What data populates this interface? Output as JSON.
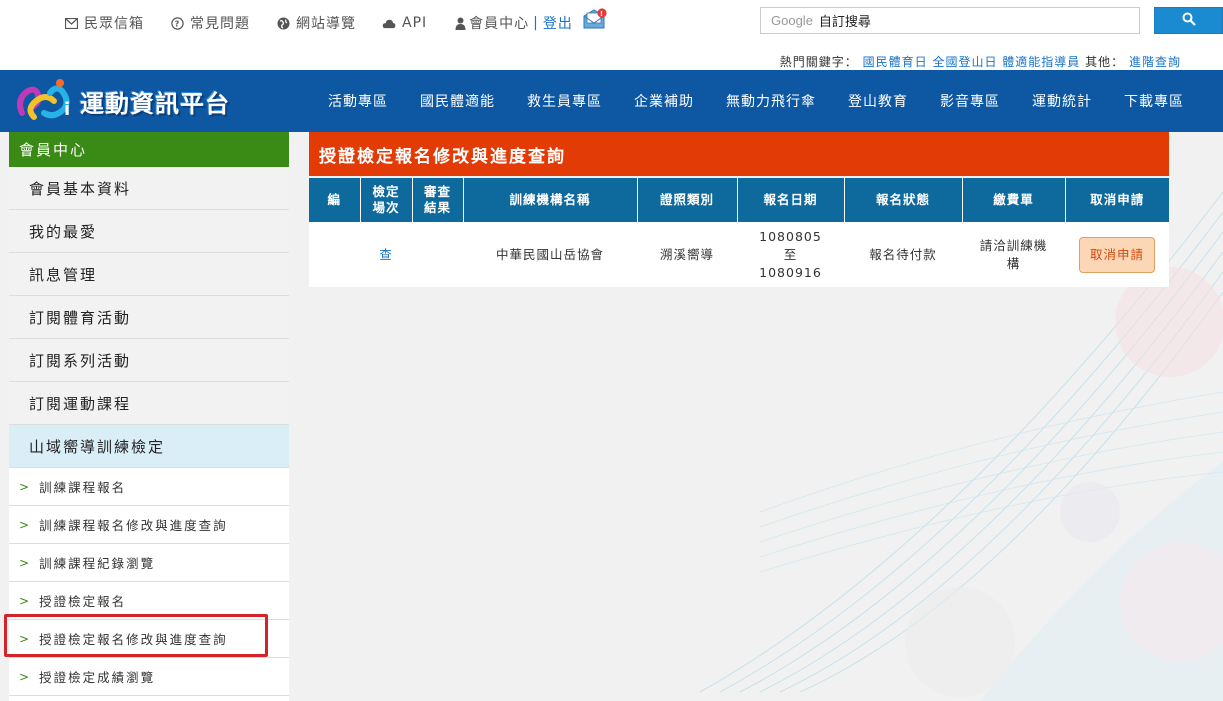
{
  "topbar": {
    "links": [
      {
        "label": "民眾信箱",
        "icon": "envelope-icon"
      },
      {
        "label": "常見問題",
        "icon": "question-icon"
      },
      {
        "label": "網站導覽",
        "icon": "globe-icon"
      },
      {
        "label": "API",
        "icon": "cloud-icon"
      }
    ],
    "member_label": "會員中心",
    "logout_label": "登出",
    "separator": "|",
    "search_brand": "Google",
    "search_placeholder": "自訂搜尋",
    "hotkeys_label": "熱門關鍵字：",
    "hotkeys": [
      "國民體育日",
      "全國登山日",
      "體適能指導員"
    ],
    "other_label": "其他：",
    "advanced_search": "進階查詢"
  },
  "nav": {
    "logo_text": "運動資訊平台",
    "items": [
      "活動專區",
      "國民體適能",
      "救生員專區",
      "企業補助",
      "無動力飛行傘",
      "登山教育",
      "影音專區",
      "運動統計",
      "下載專區"
    ]
  },
  "sidebar": {
    "header": "會員中心",
    "items": [
      "會員基本資料",
      "我的最愛",
      "訊息管理",
      "訂閱體育活動",
      "訂閱系列活動",
      "訂閱運動課程",
      "山域嚮導訓練檢定"
    ],
    "subitems": [
      "訓練課程報名",
      "訓練課程報名修改與進度查詢",
      "訓練課程紀錄瀏覽",
      "授證檢定報名",
      "授證檢定報名修改與進度查詢",
      "授證檢定成績瀏覽"
    ],
    "active_index": 6,
    "highlighted_sub_index": 4
  },
  "main": {
    "title": "授證檢定報名修改與進度查詢",
    "table": {
      "headers": [
        "編",
        "檢定\n場次",
        "審查\n結果",
        "訓練機構名稱",
        "證照類別",
        "報名日期",
        "報名狀態",
        "繳費單",
        "取消申請"
      ],
      "rows": [
        {
          "no": "",
          "session": "查",
          "review": "",
          "org": "中華民國山岳協會",
          "category": "溯溪嚮導",
          "date_start": "1080805",
          "date_to": "至",
          "date_end": "1080916",
          "status": "報名待付款",
          "payment": "請洽訓練機構",
          "cancel_label": "取消申請"
        }
      ]
    }
  },
  "colors": {
    "nav_bg": "#0d57a3",
    "sidebar_header": "#3a8a16",
    "title_bar": "#e23b06",
    "table_header": "#0e6a9c",
    "link": "#1a73c8",
    "highlight": "#d4242a"
  }
}
